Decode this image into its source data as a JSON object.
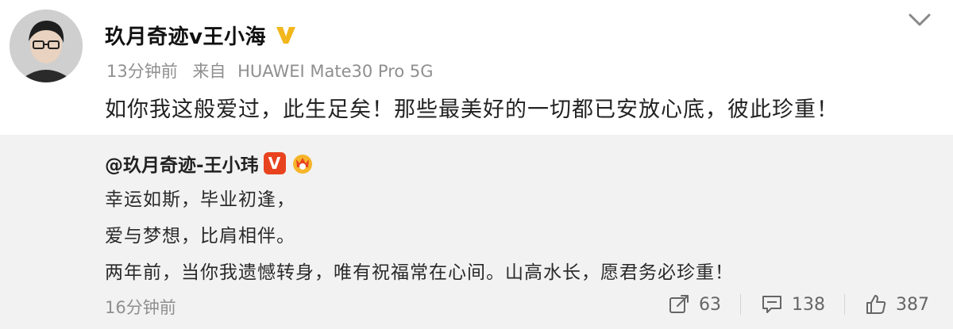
{
  "post": {
    "author_name": "玖月奇迹v王小海",
    "timestamp": "13分钟前",
    "source_prefix": "来自",
    "device": "HUAWEI Mate30 Pro 5G",
    "text": "如你我这般爱过，此生足矣！那些最美好的一切都已安放心底，彼此珍重！",
    "icons": {
      "verified": "verified-v-icon",
      "menu": "chevron-down-icon",
      "avatar": "avatar"
    }
  },
  "repost": {
    "author_handle": "@玖月奇迹-王小玮",
    "badge_v_label": "V",
    "lines": [
      "幸运如斯，毕业初逢，",
      "爱与梦想，比肩相伴。",
      "两年前，当你我遗憾转身，唯有祝福常在心间。山高水长，愿君务必珍重！"
    ],
    "timestamp": "16分钟前",
    "actions": {
      "share_count": "63",
      "comment_count": "138",
      "like_count": "387"
    },
    "colors": {
      "background": "#f2f2f2",
      "badge_v": "#e8431f",
      "verified_gold": "#f2b71c"
    }
  }
}
